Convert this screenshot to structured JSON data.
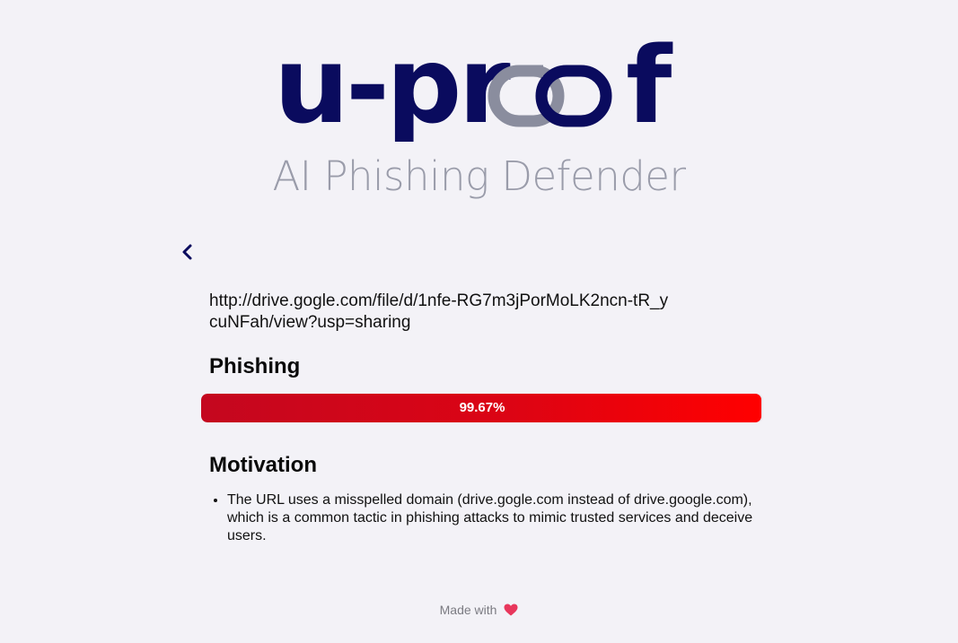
{
  "brand": {
    "logo_text": "u-proof",
    "tagline": "AI Phishing Defender"
  },
  "result": {
    "url": "http://drive.gogle.com/file/d/1nfe-RG7m3jPorMoLK2ncn-tR_ycuNFah/view?usp=sharing",
    "verdict": "Phishing",
    "probability_label": "99.67%",
    "probability": 99.67
  },
  "motivation": {
    "heading": "Motivation",
    "reasons": [
      "The URL uses a misspelled domain (drive.gogle.com instead of drive.google.com), which is a common tactic in phishing attacks to mimic trusted services and deceive users."
    ]
  },
  "footer": {
    "text": "Made with"
  },
  "icons": {
    "back": "chevron-left-icon",
    "footer": "heart-icon"
  },
  "colors": {
    "brand_navy": "#0a0b5e",
    "link_gray": "#8a8d9e",
    "phishing_red": "#ff0000",
    "heart": "#e8375c"
  }
}
